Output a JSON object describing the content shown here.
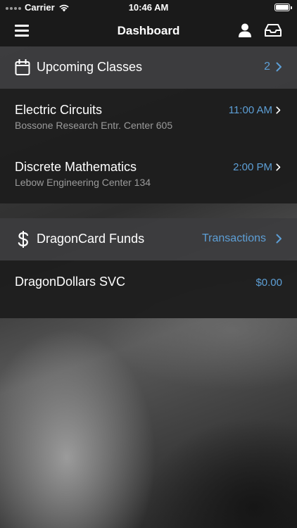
{
  "status_bar": {
    "carrier": "Carrier",
    "time": "10:46 AM",
    "battery_level": 1.0
  },
  "nav": {
    "title": "Dashboard",
    "menu_icon": "hamburger-menu-icon",
    "profile_icon": "user-icon",
    "inbox_icon": "inbox-icon"
  },
  "upcoming_classes": {
    "title": "Upcoming Classes",
    "count": "2",
    "icon": "calendar-icon",
    "items": [
      {
        "name": "Electric Circuits",
        "location": "Bossone Research Entr. Center 605",
        "time": "11:00 AM"
      },
      {
        "name": "Discrete Mathematics",
        "location": "Lebow Engineering Center 134",
        "time": "2:00 PM"
      }
    ]
  },
  "dragoncard": {
    "title": "DragonCard Funds",
    "link": "Transactions",
    "icon": "dollar-sign-icon",
    "items": [
      {
        "name": "DragonDollars SVC",
        "amount": "$0.00"
      }
    ]
  },
  "colors": {
    "accent": "#5d9fd6",
    "bar_background": "#1a1a1a",
    "section_header": "#3c3c3e",
    "card": "#1e1e1e",
    "subtext": "#9b9b9b"
  }
}
